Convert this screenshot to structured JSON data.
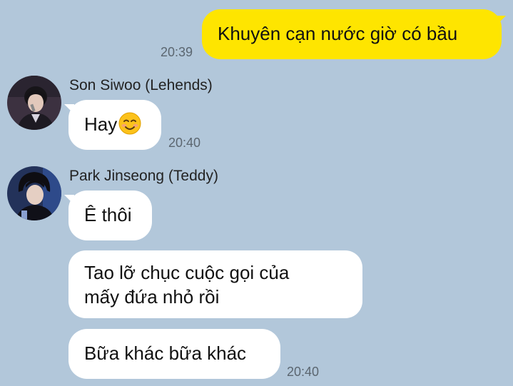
{
  "messages": [
    {
      "text": "Khuyên cạn nước giờ có bầu",
      "time": "20:39"
    },
    {
      "sender": "Son Siwoo (Lehends)",
      "text": "Hay",
      "emoji": "smiling-face-emoji",
      "time": "20:40"
    },
    {
      "sender": "Park Jinseong (Teddy)",
      "text": "Ê thôi"
    },
    {
      "text_line1": "Tao lỡ chục cuộc gọi của",
      "text_line2": "mấy đứa nhỏ rồi"
    },
    {
      "text": "Bữa khác bữa khác",
      "time": "20:40"
    }
  ],
  "colors": {
    "background": "#b2c7da",
    "my_bubble": "#fee500",
    "their_bubble": "#ffffff"
  }
}
